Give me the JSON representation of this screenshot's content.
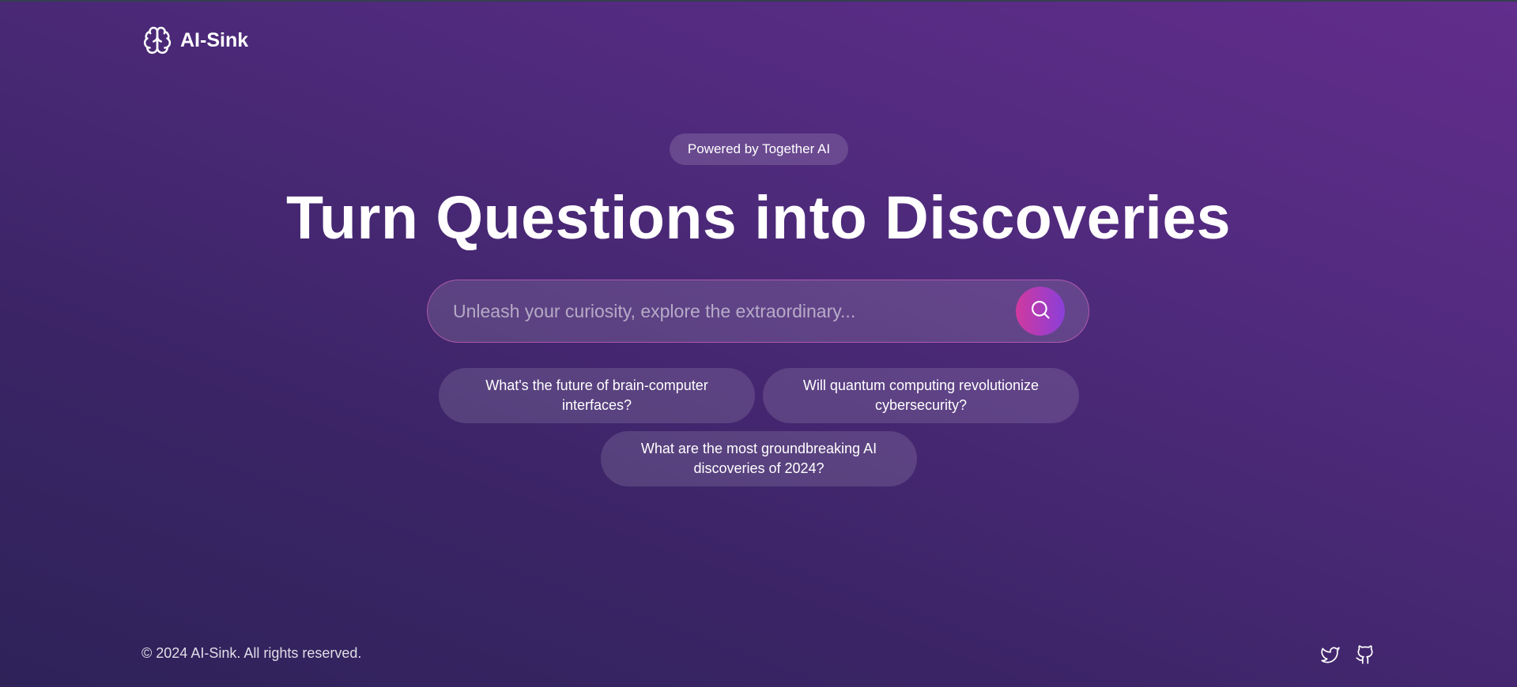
{
  "brand": {
    "name": "AI-Sink",
    "logo_icon": "brain-icon"
  },
  "hero": {
    "badge": "Powered by Together AI",
    "title": "Turn Questions into Discoveries"
  },
  "search": {
    "placeholder": "Unleash your curiosity, explore the extraordinary...",
    "value": "",
    "button_icon": "search-icon"
  },
  "suggestions": [
    "What's the future of brain-computer interfaces?",
    "Will quantum computing revolutionize cybersecurity?",
    "What are the most groundbreaking AI discoveries of 2024?"
  ],
  "footer": {
    "copyright": "© 2024 AI-Sink. All rights reserved.",
    "social": [
      "twitter-icon",
      "github-icon"
    ]
  },
  "colors": {
    "background_start": "#622d8c",
    "background_end": "#2e2259",
    "accent_pink": "#d0399f",
    "accent_purple": "#8a3fd9"
  }
}
